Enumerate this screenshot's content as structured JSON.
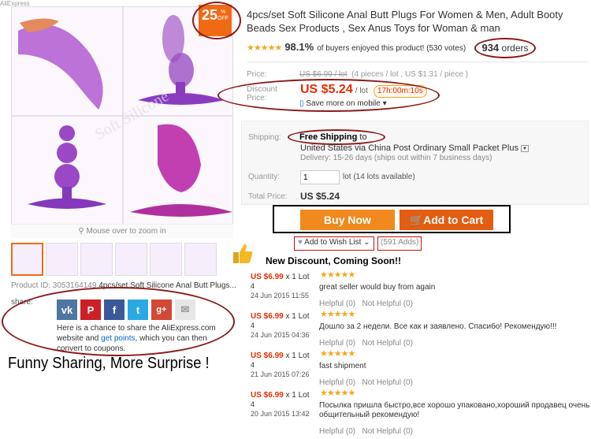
{
  "corner_note": "AliExpress",
  "discount_badge": {
    "value": "25",
    "pct": "%",
    "off": "OFF"
  },
  "zoom_hint": "Mouse over to zoom in",
  "product_id": "Product ID: 3053164149",
  "product_name_short": "4pcs/set Soft Silicone Anal Butt Plugs...",
  "share": {
    "label": "share:",
    "icons": [
      "vk-icon",
      "pinterest-icon",
      "facebook-icon",
      "twitter-icon",
      "google-plus-icon",
      "email-icon"
    ],
    "text_prefix": "Here is a chance to share the AliExpress.com website and ",
    "link": "get points",
    "text_suffix": ", which you can then convert to coupons."
  },
  "funny_banner": "Funny Sharing, More Surprise !",
  "title": "4pcs/set Soft Silicone Anal Butt Plugs For Women & Men, Adult Booty Beads Sex Products , Sex Anus Toys for Woman & man",
  "rating": {
    "stars": "★★★★★",
    "percent": "98.1%",
    "text": "of buyers enjoyed this product! (530 votes)",
    "orders_count": "934",
    "orders_label": "orders"
  },
  "price": {
    "label": "Price:",
    "old": "US $6.99 / lot",
    "old_note": "(4 pieces / lot , US $1.31 / piece )",
    "discount_label_1": "Discount",
    "discount_label_2": "Price:",
    "new": "US $5.24",
    "unit": "/ lot",
    "timer": "17h:00m:10s",
    "mobile": "Save more on mobile"
  },
  "shipping": {
    "label": "Shipping:",
    "free": "Free Shipping",
    "to": "to",
    "method": "United States via China Post Ordinary Small Packet Plus",
    "delivery": "Delivery: 15-26 days (ships out within 7 business days)"
  },
  "quantity": {
    "label": "Quantity:",
    "value": "1",
    "note": "lot (14 lots available)"
  },
  "total": {
    "label": "Total Price:",
    "value": "US $5.24"
  },
  "buttons": {
    "buy_now": "Buy Now",
    "add_to_cart": "Add to Cart"
  },
  "wish": {
    "label": "Add to Wish List",
    "adds": "(591 Adds)"
  },
  "new_discount": "New Discount, Coming Soon!!",
  "reviews": [
    {
      "price": "US $6.99",
      "qty": " x 1 Lot",
      "cut": "4",
      "date": "24 Jun 2015 11:55",
      "stars": "★★★★★",
      "text": "great seller would buy from again",
      "helpful": "Helpful (0)",
      "not_helpful": "Not Helpful (0)"
    },
    {
      "price": "US $6.99",
      "qty": " x 1 Lot",
      "cut": "4",
      "date": "24 Jun 2015 04:36",
      "stars": "★★★★★",
      "text": "Дошло за 2 недели. Все как и заявлено. Спасибо! Рекомендую!!!",
      "helpful": "Helpful (0)",
      "not_helpful": "Not Helpful (0)"
    },
    {
      "price": "US $6.99",
      "qty": " x 1 Lot",
      "cut": "4",
      "date": "21 Jun 2015 07:26",
      "stars": "★★★★★",
      "text": "fast shipment",
      "helpful": "Helpful (0)",
      "not_helpful": "Not Helpful (0)"
    },
    {
      "price": "US $6.99",
      "qty": " x 1 Lot",
      "cut": "4",
      "date": "20 Jun 2015 13:42",
      "stars": "★★★★★",
      "text": "Посылка пришла быстро,все хорошо упаковано,хороший продавец очень общительный рекомендую!",
      "helpful": "Helpful (0)",
      "not_helpful": "Not Helpful (0)"
    }
  ],
  "colors": {
    "accent_orange": "#f06a16",
    "price_red": "#e62e04",
    "ring_red": "#8b1a1a",
    "buy_now": "#f08a1e",
    "add_to_cart": "#e35d12"
  }
}
